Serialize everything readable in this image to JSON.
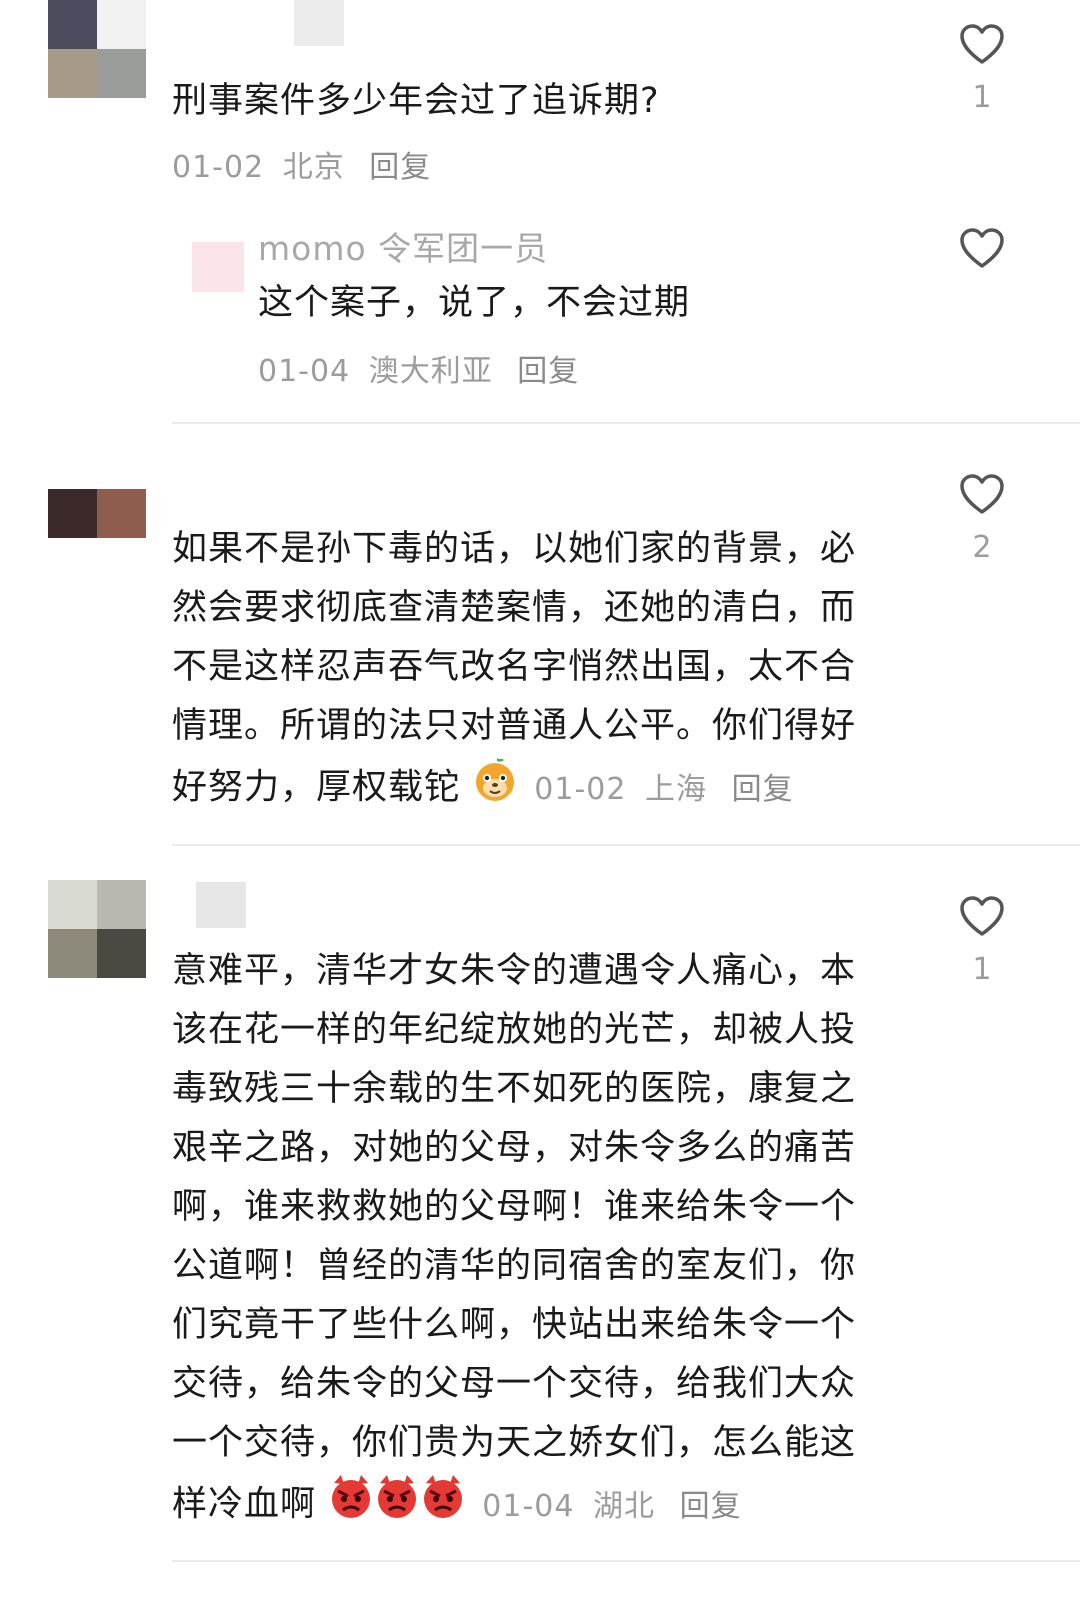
{
  "comments": [
    {
      "text": "刑事案件多少年会过了追诉期?",
      "date": "01-02",
      "location": "北京",
      "reply_label": "回复",
      "likes": "1",
      "avatar_colors": [
        "#4c4c5e",
        "#f2f2f2",
        "#a79a88",
        "#9b9d9a"
      ],
      "replies": [
        {
          "name": "momo 令军团一员",
          "text": "这个案子，说了，不会过期",
          "date": "01-04",
          "location": "澳大利亚",
          "reply_label": "回复"
        }
      ]
    },
    {
      "text": "如果不是孙下毒的话，以她们家的背景，必然会要求彻底查清楚案情，还她的清白，而不是这样忍声吞气改名字悄然出国，太不合情理。所谓的法只对普通人公平。你们得好好努力，厚权载铊",
      "lines": [
        "如果不是孙下毒的话，以她们家的背景，必",
        "然会要求彻底查清楚案情，还她的清白，而",
        "不是这样忍声吞气改名字悄然出国，太不合",
        "情理。所谓的法只对普通人公平。你们得好",
        "好努力，厚权载铊"
      ],
      "date": "01-02",
      "location": "上海",
      "reply_label": "回复",
      "likes": "2",
      "avatar_colors": [
        "#ffffff",
        "#ffffff",
        "#3c2a2a",
        "#8e5d4b"
      ]
    },
    {
      "text": "意难平，清华才女朱令的遭遇令人痛心，本该在花一样的年纪绽放她的光芒，却被人投毒致残三十余载的生不如死的医院，康复之艰辛之路，对她的父母，对朱令多么的痛苦啊，谁来救救她的父母啊！谁来给朱令一个公道啊！曾经的清华的同宿舍的室友们，你们究竟干了些什么啊，快站出来给朱令一个交待，给朱令的父母一个交待，给我们大众一个交待，你们贵为天之娇女们，怎么能这样冷血啊",
      "lines": [
        "意难平，清华才女朱令的遭遇令人痛心，本",
        "该在花一样的年纪绽放她的光芒，却被人投",
        "毒致残三十余载的生不如死的医院，康复之",
        "艰辛之路，对她的父母，对朱令多么的痛苦",
        "啊，谁来救救她的父母啊！谁来给朱令一个",
        "公道啊！曾经的清华的同宿舍的室友们，你",
        "们究竟干了些什么啊，快站出来给朱令一个",
        "交待，给朱令的父母一个交待，给我们大众",
        "一个交待，你们贵为天之娇女们，怎么能这",
        "样冷血啊"
      ],
      "date": "01-04",
      "location": "湖北",
      "reply_label": "回复",
      "likes": "1",
      "avatar_colors": [
        "#d9dad2",
        "#b9b8b0",
        "#8d8a7c",
        "#4a4a42"
      ]
    }
  ],
  "icons": {
    "like": "heart-outline-icon",
    "emoji_1": "orange-dog-face-emoji",
    "emoji_angry": "angry-face-emoji"
  }
}
